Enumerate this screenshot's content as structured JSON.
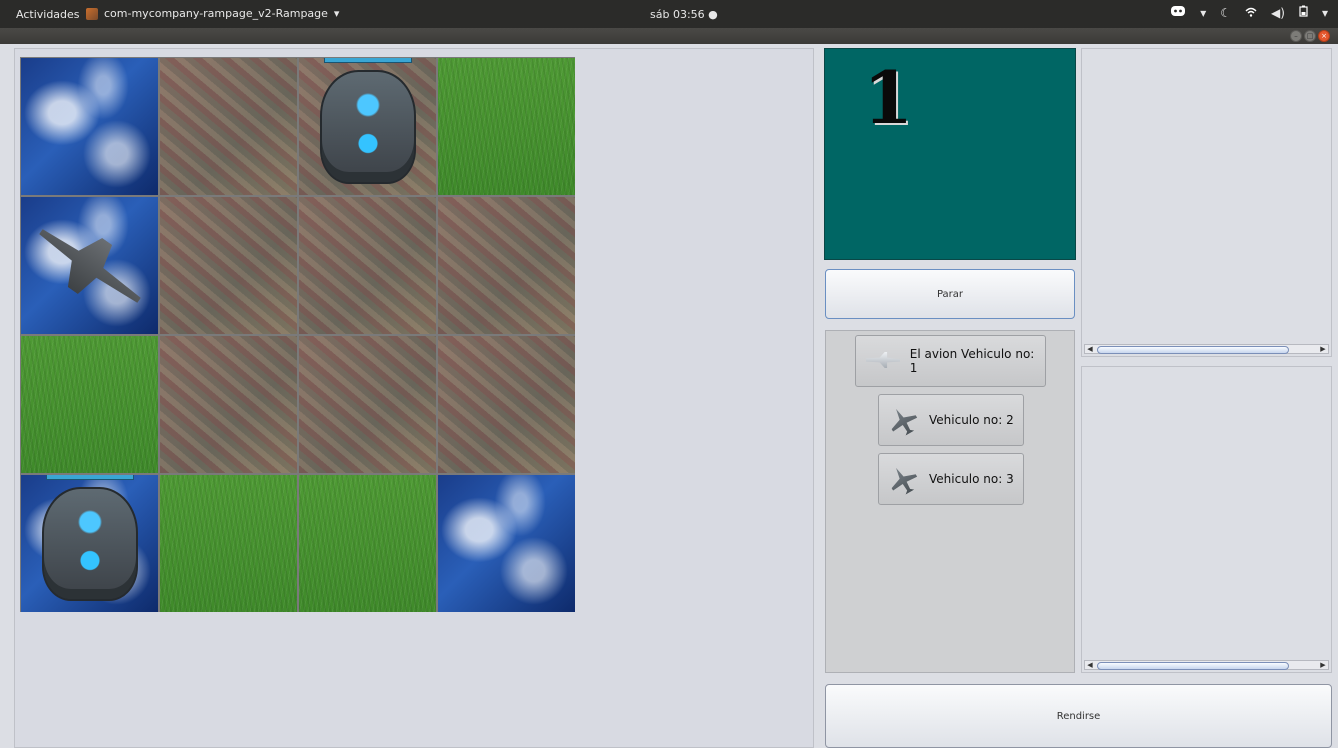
{
  "topbar": {
    "activities": "Actividades",
    "app_name": "com-mycompany-rampage_v2-Rampage",
    "app_menu_arrow": "▾",
    "clock": "sáb 03:56",
    "clock_dot": "●",
    "tray_icons": [
      "discord-icon",
      "dropdown-icon",
      "night-light-icon",
      "wifi-icon",
      "volume-icon",
      "battery-icon",
      "system-menu-icon"
    ]
  },
  "board": {
    "rows": 4,
    "cols": 4,
    "tiles": [
      {
        "terrain": "water",
        "unit": null
      },
      {
        "terrain": "mountain",
        "unit": null
      },
      {
        "terrain": "mountain",
        "unit": "tower"
      },
      {
        "terrain": "grass",
        "unit": null
      },
      {
        "terrain": "water",
        "unit": "jet"
      },
      {
        "terrain": "mountain",
        "unit": null
      },
      {
        "terrain": "mountain",
        "unit": null
      },
      {
        "terrain": "mountain",
        "unit": null
      },
      {
        "terrain": "grass",
        "unit": null
      },
      {
        "terrain": "mountain",
        "unit": null
      },
      {
        "terrain": "mountain",
        "unit": null
      },
      {
        "terrain": "mountain",
        "unit": null
      },
      {
        "terrain": "water",
        "unit": "tower"
      },
      {
        "terrain": "grass",
        "unit": null
      },
      {
        "terrain": "grass",
        "unit": null
      },
      {
        "terrain": "water",
        "unit": null
      }
    ]
  },
  "display": {
    "turn_number": "1",
    "background": "#006664"
  },
  "controls": {
    "stop_label": "Parar",
    "surrender_label": "Rendirse"
  },
  "vehicles": [
    {
      "label": "El avion Vehiculo no: 1",
      "icon": "airplane-icon"
    },
    {
      "label": "Vehiculo no: 2",
      "icon": "fighter-jet-icon"
    },
    {
      "label": "Vehiculo no: 3",
      "icon": "fighter-jet-icon"
    }
  ]
}
